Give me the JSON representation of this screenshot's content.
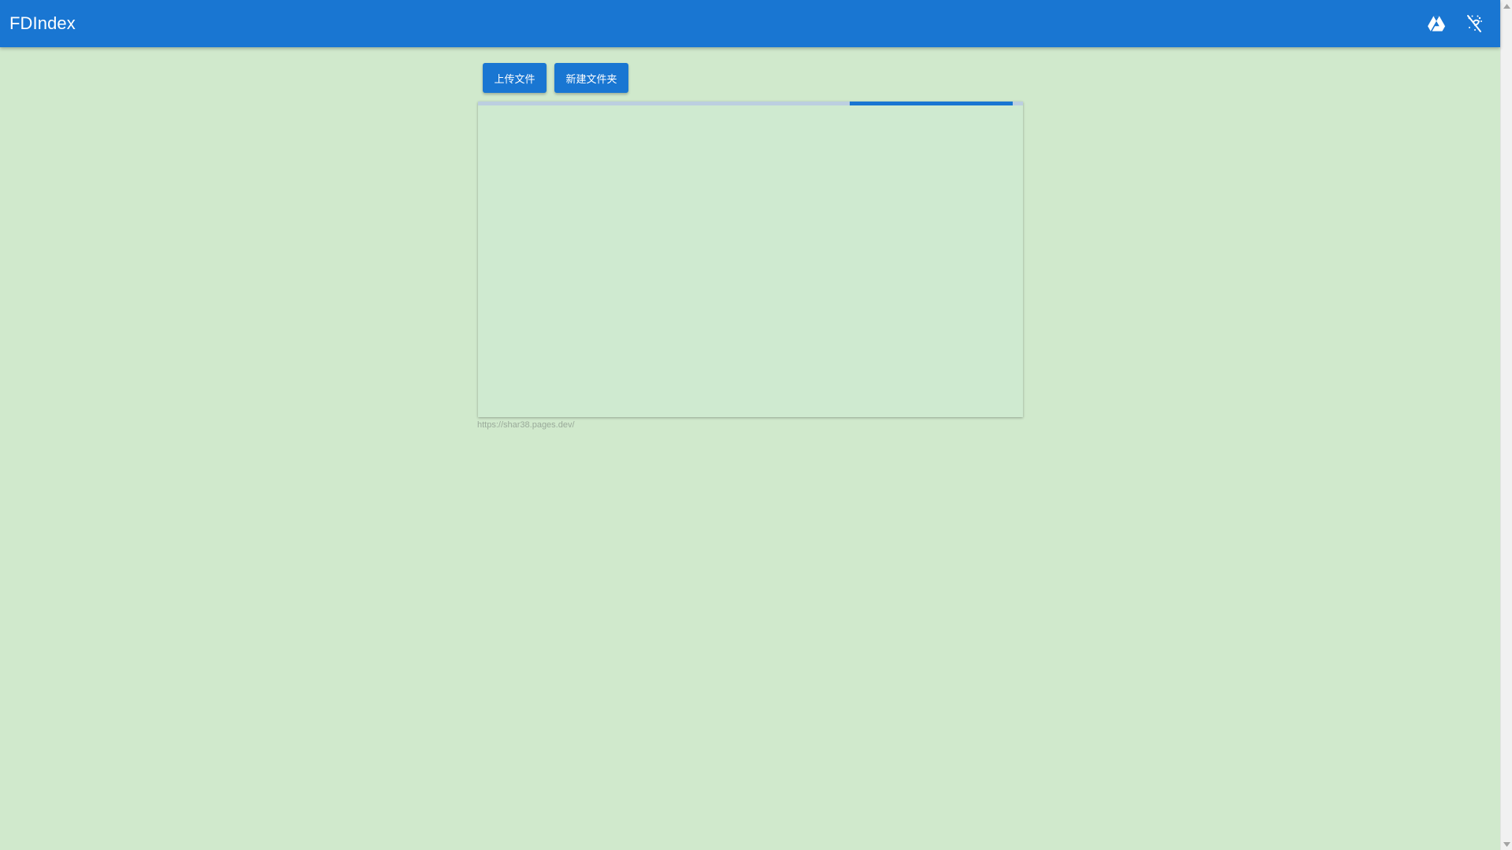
{
  "app": {
    "title": "FDIndex"
  },
  "header": {
    "icons": [
      "google-drive-icon",
      "theme-toggle-icon"
    ]
  },
  "toolbar": {
    "upload_label": "上传文件",
    "new_folder_label": "新建文件夹"
  },
  "loading": {
    "indeterminate": true
  },
  "footer": {
    "link_text": "https://shar38.pages.dev/"
  },
  "colors": {
    "primary": "#1976d2",
    "background": "#d0e9cc",
    "footer_text": "#9aaa9a"
  }
}
